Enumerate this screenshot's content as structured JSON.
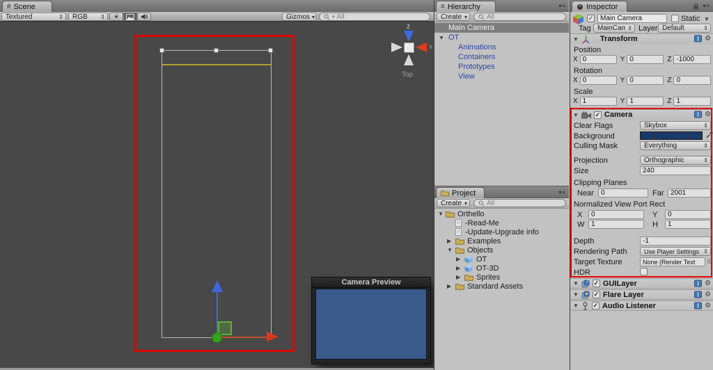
{
  "icons": {
    "foldout_open": "▼",
    "foldout_closed": "▶",
    "dropdown": "⇕",
    "small_arrow": "▾",
    "check": "✓",
    "gear": "⚙",
    "menu": "≡",
    "hash": "#",
    "picker": "◎",
    "sun": "☀",
    "static_dropdown": "▼"
  },
  "colors": {
    "annotation_red": "#dd0400",
    "prefab_blue": "#2c45a8",
    "camera_background_swatch": "#1b3968",
    "camera_preview_blue": "#3a5a8c",
    "selection_gray": "#7d7d7d",
    "scene_guide_yellow": "#b1a12e"
  },
  "scene": {
    "tab": "Scene",
    "toolbar": {
      "shading": "Textured",
      "channel": "RGB",
      "gizmos": "Gizmos",
      "search_placeholder": "All"
    },
    "orientation_gizmo": {
      "view_label": "Top",
      "z_axis": "z",
      "x_axis": "x"
    },
    "camera_preview": {
      "title": "Camera Preview"
    }
  },
  "hierarchy": {
    "tab": "Hierarchy",
    "create_button": "Create",
    "search_placeholder": "All",
    "items": [
      {
        "label": "Main Camera"
      },
      {
        "label": "OT"
      },
      {
        "label": "Animations"
      },
      {
        "label": "Containers"
      },
      {
        "label": "Prototypes"
      },
      {
        "label": "View"
      }
    ]
  },
  "project": {
    "tab": "Project",
    "create_button": "Create",
    "search_placeholder": "All",
    "tree": [
      {
        "label": "Orthello"
      },
      {
        "label": "-Read-Me"
      },
      {
        "label": "-Update-Upgrade info"
      },
      {
        "label": "Examples"
      },
      {
        "label": "Objects"
      },
      {
        "label": "OT"
      },
      {
        "label": "OT-3D"
      },
      {
        "label": "Sprites"
      },
      {
        "label": "Standard Assets"
      }
    ]
  },
  "inspector": {
    "tab": "Inspector",
    "game_object": {
      "name": "Main Camera",
      "static_label": "Static",
      "tag_label": "Tag",
      "tag_value": "MainCamer",
      "layer_label": "Layer",
      "layer_value": "Default"
    },
    "transform": {
      "title": "Transform",
      "position_label": "Position",
      "rotation_label": "Rotation",
      "scale_label": "Scale",
      "x_label": "X",
      "y_label": "Y",
      "z_label": "Z",
      "position": {
        "x": "0",
        "y": "0",
        "z": "-1000"
      },
      "rotation": {
        "x": "0",
        "y": "0",
        "z": "0"
      },
      "scale": {
        "x": "1",
        "y": "1",
        "z": "1"
      }
    },
    "camera": {
      "title": "Camera",
      "clear_flags_label": "Clear Flags",
      "clear_flags_value": "Skybox",
      "background_label": "Background",
      "culling_mask_label": "Culling Mask",
      "culling_mask_value": "Everything",
      "projection_label": "Projection",
      "projection_value": "Orthographic",
      "size_label": "Size",
      "size_value": "240",
      "clipping_planes_label": "Clipping Planes",
      "near_label": "Near",
      "near_value": "0",
      "far_label": "Far",
      "far_value": "2001",
      "viewport_rect_label": "Normalized View Port Rect",
      "vx_label": "X",
      "vx_value": "0",
      "vy_label": "Y",
      "vy_value": "0",
      "vw_label": "W",
      "vw_value": "1",
      "vh_label": "H",
      "vh_value": "1",
      "depth_label": "Depth",
      "depth_value": "-1",
      "rendering_path_label": "Rendering Path",
      "rendering_path_value": "Use Player Settings",
      "target_texture_label": "Target Texture",
      "target_texture_value": "None (Render Text",
      "hdr_label": "HDR"
    },
    "components": [
      {
        "title": "GUILayer"
      },
      {
        "title": "Flare Layer"
      },
      {
        "title": "Audio Listener"
      }
    ]
  }
}
